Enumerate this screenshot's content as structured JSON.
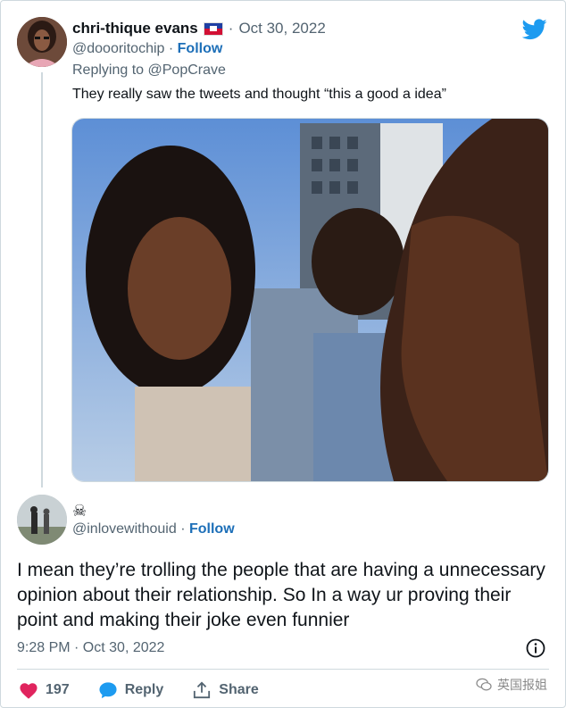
{
  "tweet1": {
    "display_name": "chri-thique evans",
    "date_sep": "·",
    "date": "Oct 30, 2022",
    "handle": "@doooritochip",
    "follow_sep": "·",
    "follow_label": "Follow",
    "replying_prefix": "Replying to",
    "replying_to": "@PopCrave",
    "text": "They really saw the tweets and thought “this a good a idea”",
    "flag_icon": "haiti-flag-icon"
  },
  "tweet2": {
    "name_emoji": "☠",
    "handle": "@inlovewithouid",
    "follow_sep": "·",
    "follow_label": "Follow",
    "text": "I mean they’re trolling the people that are having a unnecessary opinion about their relationship. So In a way ur proving their point and making their joke even funnier",
    "timestamp": "9:28 PM · Oct 30, 2022"
  },
  "actions": {
    "like_count": "197",
    "reply_label": "Reply",
    "share_label": "Share"
  },
  "watermark": {
    "text": "英国报姐"
  },
  "colors": {
    "like": "#e0245e",
    "reply": "#1d9bf0",
    "link": "#1d6fb8",
    "twitter": "#1d9bf0"
  }
}
